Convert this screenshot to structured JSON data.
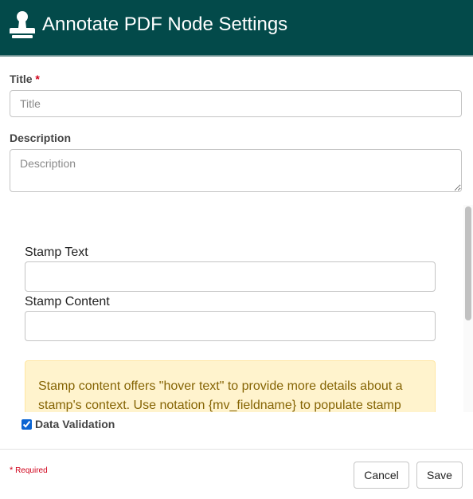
{
  "header": {
    "title": "Annotate PDF Node Settings",
    "icon": "stamp-icon",
    "background": "#034a4a"
  },
  "form": {
    "title_label": "Title",
    "required_star": "*",
    "title_placeholder": "Title",
    "title_value": "",
    "description_label": "Description",
    "description_placeholder": "Description",
    "description_value": ""
  },
  "stamp": {
    "stamp_text_label": "Stamp Text",
    "stamp_text_value": "",
    "stamp_content_label": "Stamp Content",
    "stamp_content_value": "",
    "info_text": "Stamp content offers \"hover text\" to provide more details about a stamp's context. Use notation {mv_fieldname} to populate stamp"
  },
  "validation": {
    "label": "Data Validation",
    "checked": true
  },
  "footer": {
    "required_star": "*",
    "required_note": "Required",
    "cancel_label": "Cancel",
    "save_label": "Save"
  }
}
